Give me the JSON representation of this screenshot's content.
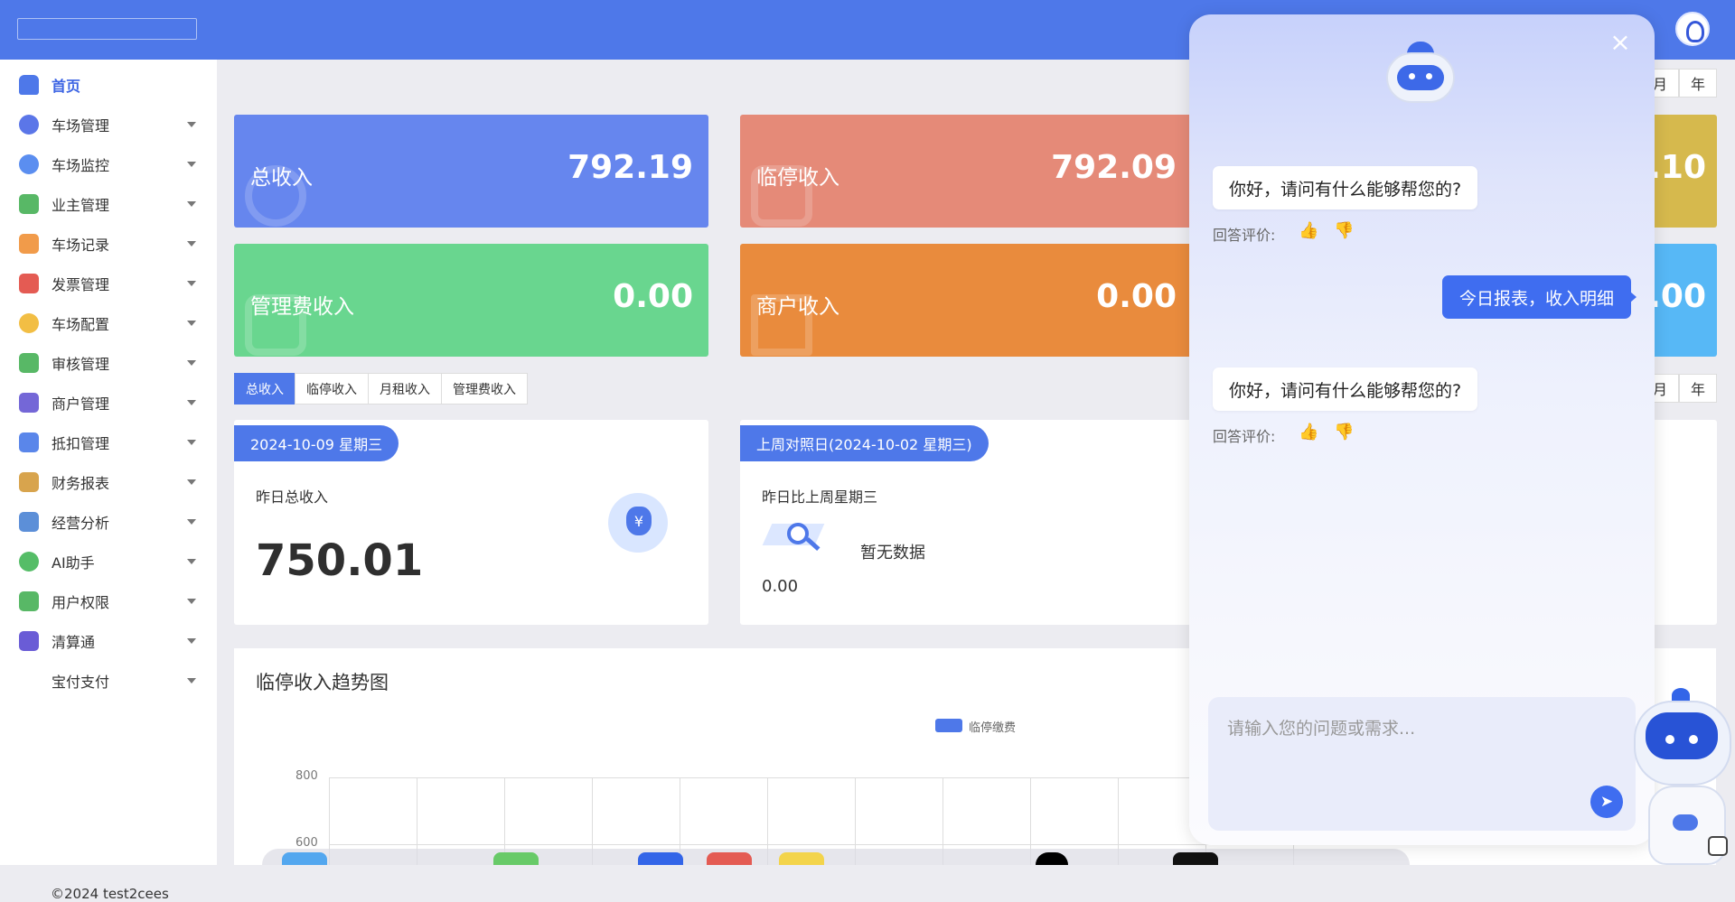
{
  "sidebar": {
    "items": [
      {
        "label": "首页",
        "icon": "home-icon",
        "color": "#4e78e9"
      },
      {
        "label": "车场管理",
        "icon": "parking-icon",
        "color": "#5b76e8"
      },
      {
        "label": "车场监控",
        "icon": "camera-icon",
        "color": "#5b8ef0"
      },
      {
        "label": "业主管理",
        "icon": "user-icon",
        "color": "#58b866"
      },
      {
        "label": "车场记录",
        "icon": "record-icon",
        "color": "#f19b4a"
      },
      {
        "label": "发票管理",
        "icon": "invoice-icon",
        "color": "#e45b53"
      },
      {
        "label": "车场配置",
        "icon": "settings-icon",
        "color": "#f2be44"
      },
      {
        "label": "审核管理",
        "icon": "audit-icon",
        "color": "#58b866"
      },
      {
        "label": "商户管理",
        "icon": "shop-icon",
        "color": "#7467d7"
      },
      {
        "label": "抵扣管理",
        "icon": "ticket-icon",
        "color": "#5a86ea"
      },
      {
        "label": "财务报表",
        "icon": "finance-icon",
        "color": "#d8a44d"
      },
      {
        "label": "经营分析",
        "icon": "analysis-icon",
        "color": "#5c8fd8"
      },
      {
        "label": "AI助手",
        "icon": "ai-icon",
        "color": "#55bd67"
      },
      {
        "label": "用户权限",
        "icon": "permission-icon",
        "color": "#58b866"
      },
      {
        "label": "清算通",
        "icon": "clearing-icon",
        "color": "#6a5cd6"
      },
      {
        "label": "宝付支付",
        "icon": "payment-icon",
        "color": "#ffffff"
      }
    ],
    "copyright": "©2024 test2cees"
  },
  "summary_cards": [
    {
      "label": "总收入",
      "value": "792.19",
      "color": "#6686ee"
    },
    {
      "label": "临停收入",
      "value": "792.09",
      "color": "#e58a78"
    },
    {
      "label": "管理费收入",
      "value": "0.00",
      "color": "#69d68f"
    },
    {
      "label": "商户收入",
      "value": "0.00",
      "color": "#e98b3d"
    }
  ],
  "right_card_values": [
    ".10",
    ".00"
  ],
  "period_tabs": {
    "month": "月",
    "year": "年"
  },
  "revenue_tabs": [
    "总收入",
    "临停收入",
    "月租收入",
    "管理费收入"
  ],
  "yesterday": {
    "date": "2024-10-09 星期三",
    "label": "昨日总收入",
    "value": "750.01"
  },
  "comparison": {
    "date": "上周对照日(2024-10-02 星期三)",
    "label": "昨日比上周星期三",
    "empty": "暂无数据",
    "value": "0.00"
  },
  "trend_chart": {
    "title": "临停收入趋势图",
    "legend": "临停缴费",
    "ticks": [
      "800",
      "600"
    ]
  },
  "chat": {
    "greeting": "你好，请问有什么能够帮您的?",
    "rate_label": "回答评价:",
    "user_message": "今日报表，收入明细",
    "input_placeholder": "请输入您的问题或需求..."
  }
}
